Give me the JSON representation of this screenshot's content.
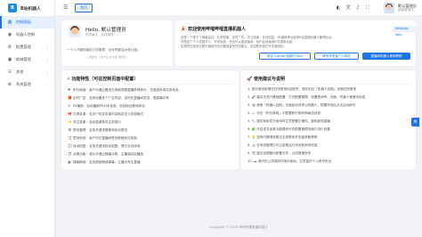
{
  "app": {
    "logo_text": "B",
    "name": "B站机器人"
  },
  "sidebar": {
    "items": [
      {
        "label": "控制面板",
        "icon": "dashboard-icon",
        "active": true,
        "has_children": false
      },
      {
        "label": "机器人控制",
        "icon": "robot-icon",
        "active": false,
        "has_children": true
      },
      {
        "label": "配置管理",
        "icon": "config-icon",
        "active": false,
        "has_children": true
      },
      {
        "label": "商城管理",
        "icon": "shop-icon",
        "active": false,
        "has_children": true
      },
      {
        "label": "其他",
        "icon": "more-icon",
        "active": false,
        "has_children": true
      },
      {
        "label": "系统管理",
        "icon": "settings-icon",
        "active": false,
        "has_children": true
      }
    ]
  },
  "topbar": {
    "home_tab": "首页",
    "user": {
      "name": "默认管理员",
      "role": "超级管理员"
    }
  },
  "welcome": {
    "hello": "Hello, 默认管理员",
    "greeting": "祝您每天，高效愉快！",
    "quote": "一个人只要知道自己去哪里，全世界都会为他让路。",
    "quote_source": "— 爱默生（拉尔夫·沃尔多·爱默生）"
  },
  "intro": {
    "title": "🎉 欢迎使用哔哩哔哩直播机器人",
    "version": "Nekobot-Web",
    "lines": [
      "这是一个基于了弹幕监控、礼物答谢、定时广告、关注感谢、自动回复、PK播报等功能的B站直播机器人管理后台。",
      "您是这个个人的国开人，开发免费，您也可以直接使用，我们会持续维护并更新功能",
      "如果您在使用过程中遇到任何问题或者有任何建议，欢迎联系我们开发者团队。"
    ],
    "buttons": {
      "github": "前往 GitHub 给我们 Star",
      "contact": "联系开发者个人网站",
      "guide": "直播间机器人使用教程"
    }
  },
  "features": {
    "title": "⚡ 功能特性（可在控制页面中配置）",
    "items": [
      {
        "icon": "❤",
        "text": "积分商城：用户可通过赠送礼物和观看直播获得积分，兑换虚拟或实体商品"
      },
      {
        "icon": "🎁",
        "text": "定时广告：支持设置多个广告内容，定时在直播间发送，提高曝光率"
      },
      {
        "icon": "✈",
        "text": "PK播报：自动播报PK对手信息，包括粉丝数和排名"
      },
      {
        "icon": "🎀",
        "text": "礼物答谢：支持个性化答谢内容和自定义答谢格式"
      },
      {
        "icon": "⭐",
        "text": "关注感谢：自动感谢新关注的观众"
      },
      {
        "icon": "🛡",
        "text": "禁言管理：支持关键词屏蔽和自动禁言"
      },
      {
        "icon": "📋",
        "text": "签到系统：用户可在直播间签到获取积分奖励"
      },
      {
        "icon": "💬",
        "text": "自动回复：支持关键词自动回复，提升互动体验"
      },
      {
        "icon": "🎵",
        "text": "点歌功能：观众可通过弹幕点歌，主播端自动播放"
      },
      {
        "icon": "🔊",
        "text": "弹幕朗读：支持语音朗读弹幕，主播可专注直播"
      }
    ]
  },
  "tips": {
    "title": "🚀 使用建议与说明",
    "items": [
      "1. 首次使用前请先扫码登录B站账号，请先前往「机器人控制」页面扫码登录",
      "2. 🎤 建议先进行基础配置：打开配置管理，设置房间号、页面、机器人等基本信息",
      "3. 🎲 使用「机器人控制」页面启动或停止机器人，配置完成后点击启动即可",
      "4. 📈 可在「积分商城」中配置积分规则和商品信息",
      "5. 🔧 插件和组件在使用时注意配置正确性，避免影响直播",
      "6. 🧩 开启或关闭各功能模块可在配置管理页面中进行设置",
      "7. 💡 如有问题请查看日志或联系开发者获取帮助",
      "8. 📊 在系统管理中可以查看运行状态和系统信息",
      "9. 🛠 建议定期备份配置文件，以防数据丢失",
      "10. ☁ 请勿在公共网络环境中使用，注意保护个人账号安全"
    ]
  },
  "footer": {
    "text": "Copyright © 2025 哔哩哔哩直播机器人"
  }
}
